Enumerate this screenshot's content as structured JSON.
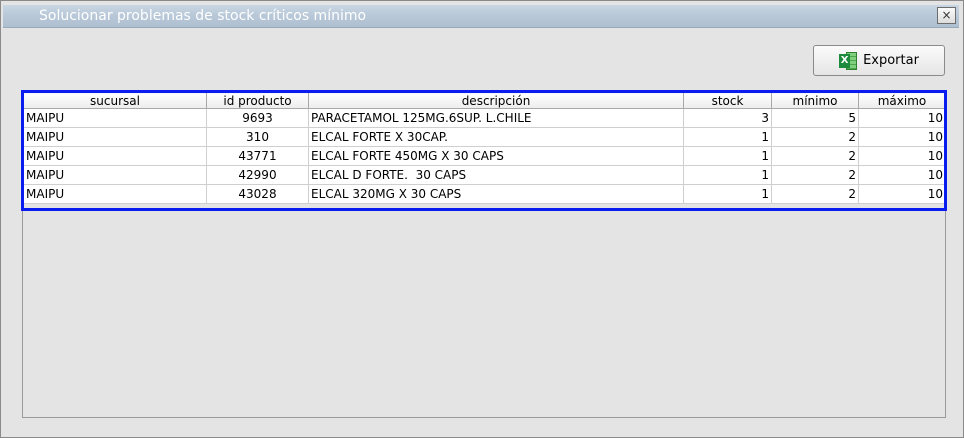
{
  "window": {
    "title": "Solucionar problemas de stock críticos mínimo",
    "close_label": "×"
  },
  "toolbar": {
    "export_label": "Exportar",
    "export_icon": "excel-icon"
  },
  "table": {
    "columns": [
      "sucursal",
      "id producto",
      "descripción",
      "stock",
      "mínimo",
      "máximo"
    ],
    "rows": [
      [
        "MAIPU",
        "9693",
        "PARACETAMOL 125MG.6SUP. L.CHILE",
        "3",
        "5",
        "10"
      ],
      [
        "MAIPU",
        "310",
        "ELCAL FORTE X 30CAP.",
        "1",
        "2",
        "10"
      ],
      [
        "MAIPU",
        "43771",
        "ELCAL FORTE 450MG X 30 CAPS",
        "1",
        "2",
        "10"
      ],
      [
        "MAIPU",
        "42990",
        "ELCAL D FORTE.  30 CAPS",
        "1",
        "2",
        "10"
      ],
      [
        "MAIPU",
        "43028",
        "ELCAL 320MG X 30 CAPS",
        "1",
        "2",
        "10"
      ]
    ]
  },
  "colors": {
    "highlight": "#0a1cf0",
    "excel_green": "#1e8a3e"
  }
}
